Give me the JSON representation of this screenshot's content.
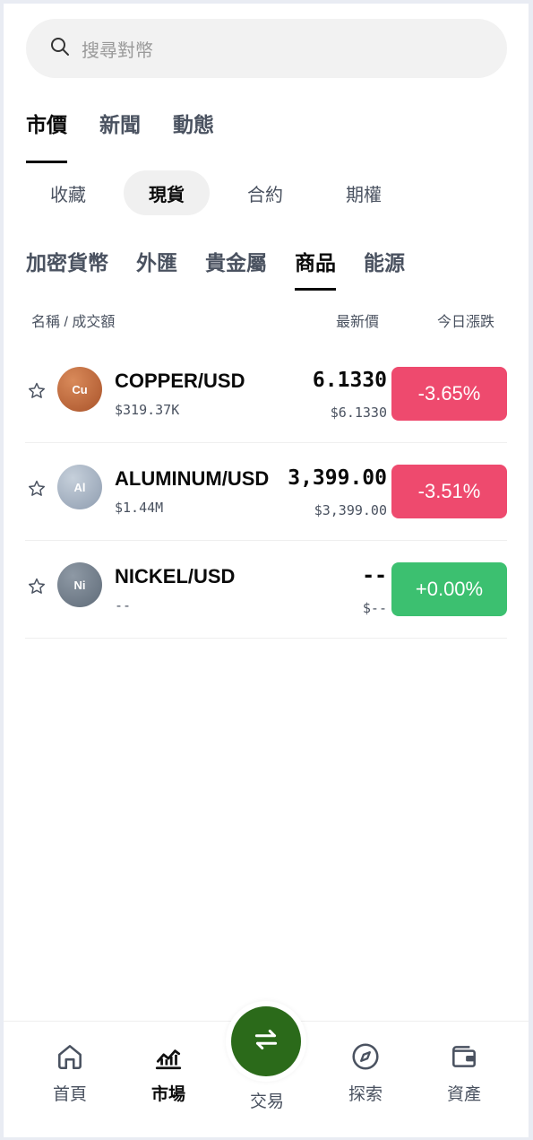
{
  "search": {
    "placeholder": "搜尋對幣"
  },
  "top_tabs": [
    {
      "label": "市價",
      "active": true
    },
    {
      "label": "新聞",
      "active": false
    },
    {
      "label": "動態",
      "active": false
    }
  ],
  "segments": [
    {
      "label": "收藏",
      "active": false
    },
    {
      "label": "現貨",
      "active": true
    },
    {
      "label": "合約",
      "active": false
    },
    {
      "label": "期權",
      "active": false
    }
  ],
  "categories": [
    {
      "label": "加密貨幣",
      "active": false
    },
    {
      "label": "外匯",
      "active": false
    },
    {
      "label": "貴金屬",
      "active": false
    },
    {
      "label": "商品",
      "active": true
    },
    {
      "label": "能源",
      "active": false
    }
  ],
  "columns": {
    "name": "名稱 / 成交額",
    "price": "最新價",
    "change": "今日漲跌"
  },
  "rows": [
    {
      "symbol": "Cu",
      "pair": "COPPER/USD",
      "volume": "$319.37K",
      "price": "6.1330",
      "sub_price": "$6.1330",
      "change": "-3.65%",
      "direction": "down"
    },
    {
      "symbol": "Al",
      "pair": "ALUMINUM/USD",
      "volume": "$1.44M",
      "price": "3,399.00",
      "sub_price": "$3,399.00",
      "change": "-3.51%",
      "direction": "down"
    },
    {
      "symbol": "Ni",
      "pair": "NICKEL/USD",
      "volume": "--",
      "price": "--",
      "sub_price": "$--",
      "change": "+0.00%",
      "direction": "up"
    }
  ],
  "colors": {
    "down": "#ee4a6e",
    "up": "#3cc070",
    "fab": "#2b6a1a",
    "copper": "#c0673b",
    "aluminum": "#a9b6c5",
    "nickel": "#727e8b"
  },
  "nav": {
    "home": {
      "label": "首頁",
      "icon": "home-icon"
    },
    "market": {
      "label": "市場",
      "icon": "chart-icon",
      "active": true
    },
    "trade": {
      "label": "交易",
      "icon": "swap-icon"
    },
    "explore": {
      "label": "探索",
      "icon": "compass-icon"
    },
    "assets": {
      "label": "資產",
      "icon": "wallet-icon"
    }
  }
}
